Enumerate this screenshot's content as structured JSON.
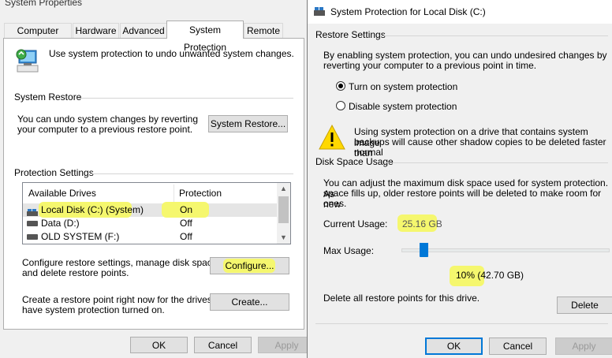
{
  "left": {
    "title": "System Properties",
    "tabs": [
      "Computer Name",
      "Hardware",
      "Advanced",
      "System Protection",
      "Remote"
    ],
    "intro": "Use system protection to undo unwanted system changes.",
    "restore": {
      "group": "System Restore",
      "desc_line1": "You can undo system changes by reverting",
      "desc_line2": "your computer to a previous restore point.",
      "button": "System Restore..."
    },
    "protection": {
      "group": "Protection Settings",
      "col_drives": "Available Drives",
      "col_protection": "Protection",
      "drives": [
        {
          "name": "Local Disk (C:) (System)",
          "status": "On"
        },
        {
          "name": "Data (D:)",
          "status": "Off"
        },
        {
          "name": "OLD SYSTEM (F:)",
          "status": "Off"
        }
      ],
      "configure_line1": "Configure restore settings, manage disk space,",
      "configure_line2": "and delete restore points.",
      "configure_button": "Configure...",
      "create_line1": "Create a restore point right now for the drives that",
      "create_line2": "have system protection turned on.",
      "create_button": "Create..."
    },
    "footer": {
      "ok": "OK",
      "cancel": "Cancel",
      "apply": "Apply"
    }
  },
  "right": {
    "title": "System Protection for Local Disk (C:)",
    "restore_group": "Restore Settings",
    "restore_desc_line1": "By enabling system protection, you can undo undesired changes by",
    "restore_desc_line2": "reverting your computer to a previous point in time.",
    "radio_on": "Turn on system protection",
    "radio_off": "Disable system protection",
    "warning_line1": "Using system protection on a drive that contains system image",
    "warning_line2": "backups will cause other shadow copies to be deleted faster than",
    "warning_line3": "normal",
    "disk_group": "Disk Space Usage",
    "disk_desc_line1": "You can adjust the maximum disk space used for system protection. As",
    "disk_desc_line2": "space fills up, older restore points will be deleted to make room for new",
    "disk_desc_line3": "ones.",
    "current_usage_label": "Current Usage:",
    "current_usage_value": "25.16 GB",
    "max_usage_label": "Max Usage:",
    "max_usage_fraction": 0.1,
    "max_usage_value": "10% (42.70 GB)",
    "delete_desc": "Delete all restore points for this drive.",
    "delete_button": "Delete",
    "footer": {
      "ok": "OK",
      "cancel": "Cancel",
      "apply": "Apply"
    }
  },
  "colors": {
    "accent": "#0078d7",
    "highlight": "#f3f56a",
    "dialog_bg": "#f0f0f0"
  }
}
